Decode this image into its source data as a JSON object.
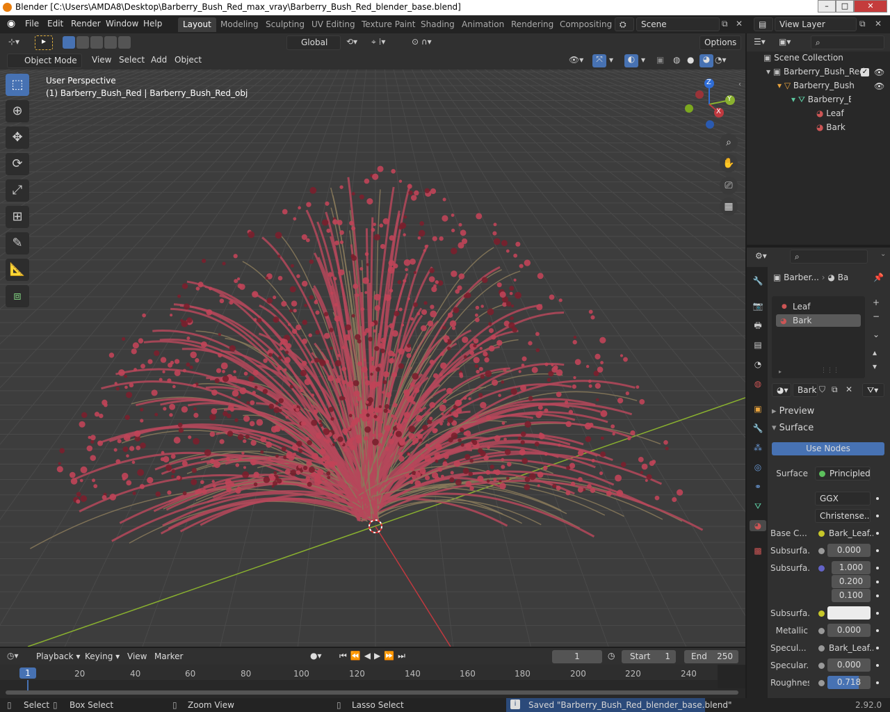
{
  "window": {
    "title": "Blender [C:\\Users\\AMDA8\\Desktop\\Barberry_Bush_Red_max_vray\\Barberry_Bush_Red_blender_base.blend]"
  },
  "menu": [
    "File",
    "Edit",
    "Render",
    "Window",
    "Help"
  ],
  "workspace_tabs": [
    "Layout",
    "Modeling",
    "Sculpting",
    "UV Editing",
    "Texture Paint",
    "Shading",
    "Animation",
    "Rendering",
    "Compositing"
  ],
  "scene": {
    "name": "Scene"
  },
  "view_layer": {
    "name": "View Layer"
  },
  "tool_header": {
    "transform_orientation": "Global",
    "options_label": "Options"
  },
  "viewport_header": {
    "mode": "Object Mode",
    "menus": [
      "View",
      "Select",
      "Add",
      "Object"
    ]
  },
  "viewport": {
    "perspective": "User Perspective",
    "object_info": "(1) Barberry_Bush_Red | Barberry_Bush_Red_obj",
    "gizmo": {
      "z": "Z",
      "y": "Y",
      "x": "X"
    }
  },
  "outliner": {
    "items": [
      "Scene Collection",
      "Barberry_Bush_Red",
      "Barberry_Bush",
      "Barberry_E",
      "Leaf",
      "Bark"
    ]
  },
  "properties": {
    "breadcrumb_object": "Barber...",
    "breadcrumb_material": "Ba",
    "material_slots": [
      "Leaf",
      "Bark"
    ],
    "material_name": "Bark",
    "panels": {
      "preview": "Preview",
      "surface": "Surface"
    },
    "use_nodes": "Use Nodes",
    "surface_label": "Surface",
    "surface_value": "Principled ...",
    "distribution": "GGX",
    "subsurface_method": "Christense...",
    "base_color": {
      "label": "Base C...",
      "value": "Bark_Leaf..."
    },
    "subsurface": {
      "label": "Subsurfa...",
      "value": "0.000"
    },
    "subsurface_radius": {
      "label": "Subsurfa...",
      "values": [
        "1.000",
        "0.200",
        "0.100"
      ]
    },
    "subsurface_color": {
      "label": "Subsurfa..."
    },
    "metallic": {
      "label": "Metallic",
      "value": "0.000"
    },
    "specular_tint_tex": {
      "label": "Specul...",
      "value": "Bark_Leaf..."
    },
    "specular": {
      "label": "Specular...",
      "value": "0.000"
    },
    "roughness": {
      "label": "Roughnes",
      "value": "0.718",
      "fraction": 0.718
    }
  },
  "timeline": {
    "menus": [
      "Playback",
      "Keying",
      "View",
      "Marker"
    ],
    "current_frame": "1",
    "start_label": "Start",
    "start": "1",
    "end_label": "End",
    "end": "250",
    "ticks": [
      "1",
      "20",
      "40",
      "60",
      "80",
      "100",
      "120",
      "140",
      "160",
      "180",
      "200",
      "220",
      "240"
    ]
  },
  "statusbar": {
    "select": "Select",
    "box_select": "Box Select",
    "zoom_view": "Zoom View",
    "lasso_select": "Lasso Select",
    "message": "Saved \"Barberry_Bush_Red_blender_base.blend\"",
    "version": "2.92.0"
  },
  "colors": {
    "accent": "#4772b3",
    "x_axis": "#c0393f",
    "y_axis": "#8ab12f",
    "z_axis": "#2f6dd6",
    "bush": "#b83a4a"
  }
}
